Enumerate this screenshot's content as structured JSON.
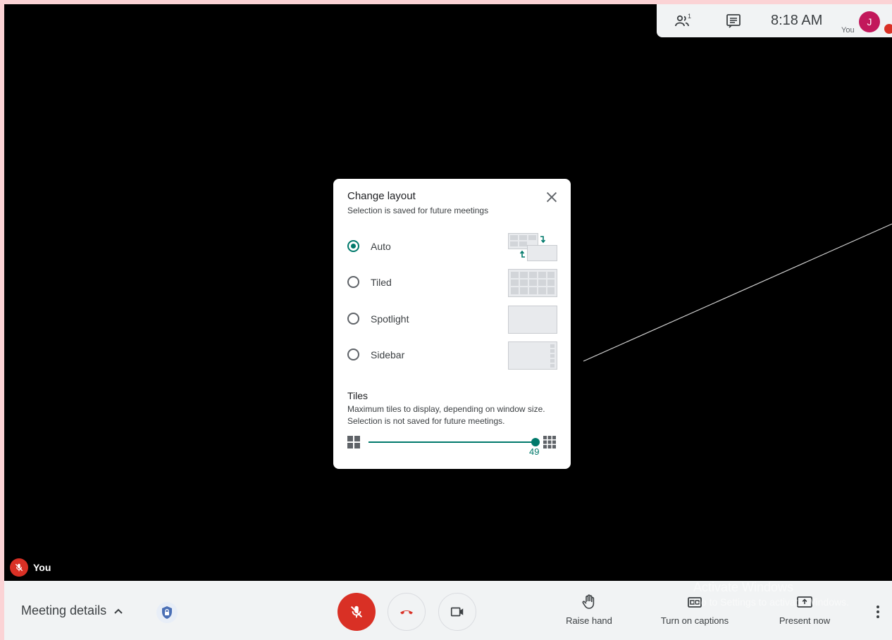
{
  "topbar": {
    "people_icon": "people-icon",
    "people_count": "1",
    "chat_icon": "chat-icon",
    "time": "8:18 AM",
    "self_label": "You",
    "avatar_initial": "J"
  },
  "tile": {
    "name": "You",
    "mic_state_icon": "mic-off-icon"
  },
  "dialog": {
    "title": "Change layout",
    "subtitle": "Selection is saved for future meetings",
    "close_icon": "close-icon",
    "options": [
      {
        "label": "Auto",
        "selected": true
      },
      {
        "label": "Tiled",
        "selected": false
      },
      {
        "label": "Spotlight",
        "selected": false
      },
      {
        "label": "Sidebar",
        "selected": false
      }
    ],
    "tiles": {
      "title": "Tiles",
      "description_line1": "Maximum tiles to display, depending on window size.",
      "description_line2": "Selection is not saved for future meetings.",
      "value": "49",
      "fill_fraction": 1.0
    }
  },
  "bottombar": {
    "meeting_details_label": "Meeting details",
    "raise_hand_label": "Raise hand",
    "captions_label": "Turn on captions",
    "present_label": "Present now"
  },
  "watermark": {
    "title": "Activate Windows",
    "subtitle": "Go to Settings to activate Windows."
  },
  "colors": {
    "accent": "#00796b",
    "danger": "#d93025",
    "avatar": "#c2185b",
    "bar_bg": "#f1f3f4"
  }
}
